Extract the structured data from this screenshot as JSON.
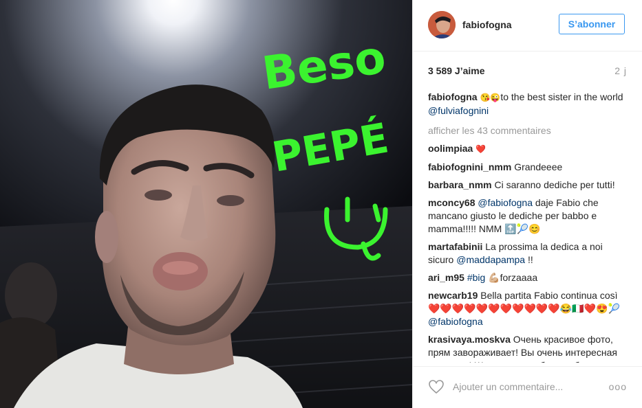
{
  "photo": {
    "overlay_word1": "Beso",
    "overlay_word2": "PEPÉ"
  },
  "header": {
    "username": "fabiofogna",
    "follow_label": "S’abonner"
  },
  "stats": {
    "likes": "3 589 J’aime",
    "time": "2 j"
  },
  "caption": {
    "user": "fabiofogna",
    "emoji": "😘😜",
    "text": "to the best sister in the world ",
    "mention": "@fulviafognini"
  },
  "more_comments": "afficher les 43 commentaires",
  "comments": [
    {
      "user": "oolimpiaa",
      "text": "❤️"
    },
    {
      "user": "fabiofognini_nmm",
      "text": "Grandeeee"
    },
    {
      "user": "barbara_nmm",
      "text": "Ci saranno dediche per tutti!"
    },
    {
      "user": "mconcy68",
      "mention": "@fabiofogna",
      "text": " daje Fabio che mancano giusto le dediche per babbo e mamma!!!!! NMM 🔝🎾😊"
    },
    {
      "user": "martafabinii",
      "text": "La prossima la dedica a noi sicuro ",
      "mention": "@maddapampa",
      "tail": " !!"
    },
    {
      "user": "ari_m95",
      "mention": "#big",
      "text": " 💪🏼forzaaaa"
    },
    {
      "user": "newcarb19",
      "text": "Bella partita Fabio continua così ❤️❤️❤️❤️❤️❤️❤️❤️❤️❤️❤️😂🇮🇹❤️😍🎾 ",
      "mention": "@fabiofogna"
    },
    {
      "user": "krasivaya.moskva",
      "text": "Очень красивое фото, прям завораживает! Вы очень интересная личность! Желаю вам добра, любви и море позитива!"
    }
  ],
  "footer": {
    "add_comment_placeholder": "Ajouter un commentaire...",
    "options": "ooo"
  },
  "colors": {
    "accent_blue": "#3897f0",
    "link_blue": "#003569",
    "marker_green": "#3bf32f"
  }
}
